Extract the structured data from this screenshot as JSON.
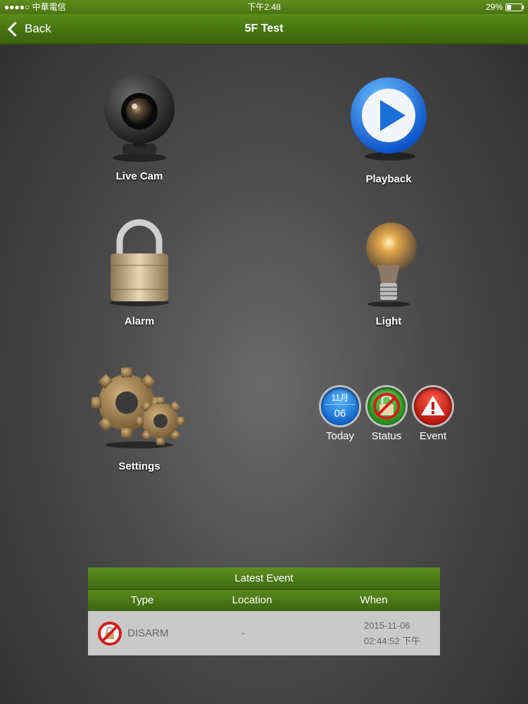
{
  "status_bar": {
    "carrier": "●●●●○ 中華電信",
    "time": "下午2:48",
    "battery": "29%",
    "battery_level": 0.29
  },
  "nav": {
    "back_label": "Back",
    "title": "5F Test"
  },
  "tiles": {
    "live_cam": "Live Cam",
    "playback": "Playback",
    "alarm": "Alarm",
    "light": "Light",
    "settings": "Settings"
  },
  "quick_buttons": {
    "today_month": "11月",
    "today_day": "06",
    "today_label": "Today",
    "status_label": "Status",
    "event_label": "Event"
  },
  "latest_event": {
    "title": "Latest Event",
    "columns": [
      "Type",
      "Location",
      "When"
    ],
    "rows": [
      {
        "type": "DISARM",
        "location": "-",
        "date": "2015-11-06",
        "time": "02:44:52 下午"
      }
    ]
  },
  "colors": {
    "bar_green": "#4b7412",
    "panel_row": "#c9c9c9"
  }
}
